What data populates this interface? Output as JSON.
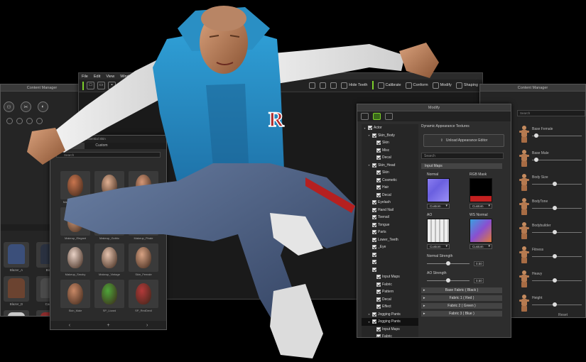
{
  "left_manager": {
    "title": "Content Manager",
    "jackets": [
      {
        "label": "Blazer_A",
        "color": "#3b4f7a"
      },
      {
        "label": "Blaz",
        "color": "#2a3140"
      },
      {
        "label": "Blazer_D",
        "color": "#6b4330"
      },
      {
        "label": "Cardi",
        "color": "#4a4a4a"
      },
      {
        "label": "Cardigan_C",
        "color": "#c9c9c9"
      },
      {
        "label": "Card",
        "color": "#8a2b2b"
      },
      {
        "label": "Hoodie_B",
        "color": "#2e6fb5"
      },
      {
        "label": "Hoo",
        "color": "#3da0d6"
      }
    ]
  },
  "app": {
    "menu": [
      "File",
      "Edit",
      "View",
      "Window"
    ],
    "toolbar": {
      "hide_teeth": "Hide Teeth",
      "calibrate": "Calibrate",
      "conform": "Conform",
      "modify": "Modify",
      "shaping": "Shaping"
    }
  },
  "template_panel": {
    "breadcrumb": "Special  ▸  Essential Skin",
    "tabs": [
      "Template",
      "Custom"
    ],
    "search_placeholder": "Search",
    "faces": [
      {
        "label": "Makeup_Bohemian",
        "color": "#c9754e"
      },
      {
        "label": "Makeup_Classic",
        "color": "#e0b092"
      },
      {
        "label": "Makeup_Diva",
        "color": "#d49777"
      },
      {
        "label": "Makeup_Elegant",
        "color": "#d9a07d"
      },
      {
        "label": "Makeup_Gothic",
        "color": "#eed7cf"
      },
      {
        "label": "Makeup_Pirate",
        "color": "#c98a63"
      },
      {
        "label": "Makeup_Smoky",
        "color": "#e9d2c6"
      },
      {
        "label": "Makeup_Vintage",
        "color": "#e5c3ae"
      },
      {
        "label": "Skin_Female",
        "color": "#d8a384"
      },
      {
        "label": "Skin_Male",
        "color": "#c88866"
      },
      {
        "label": "SP_Lizard",
        "color": "#4fa53a"
      },
      {
        "label": "SP_RedDevil",
        "color": "#b33a3a"
      }
    ],
    "footer": [
      "‹",
      "+",
      "›"
    ]
  },
  "right_manager": {
    "title": "Content Manager",
    "search_placeholder": "Search",
    "bodies": [
      {
        "label": "Base Female",
        "value": 0.05
      },
      {
        "label": "Base Male",
        "value": 0.05
      },
      {
        "label": "Body Size",
        "value": 0.45
      },
      {
        "label": "BodyTone",
        "value": 0.45
      },
      {
        "label": "Bodybuilder",
        "value": 0.45
      },
      {
        "label": "Fitness",
        "value": 0.45
      },
      {
        "label": "Heavy",
        "value": 0.45
      },
      {
        "label": "Height",
        "value": 0.45
      }
    ],
    "reset": "Reset"
  },
  "modify_panel": {
    "title": "Modify",
    "tree": [
      {
        "label": "Actor",
        "indent": 0,
        "arrow": true
      },
      {
        "label": "Skin_Body",
        "indent": 1,
        "arrow": true
      },
      {
        "label": "Skin",
        "indent": 2
      },
      {
        "label": "Misc",
        "indent": 2
      },
      {
        "label": "Decal",
        "indent": 2
      },
      {
        "label": "Skin_Head",
        "indent": 1,
        "arrow": true
      },
      {
        "label": "Skin",
        "indent": 2
      },
      {
        "label": "Cosmetic",
        "indent": 2
      },
      {
        "label": "Hair",
        "indent": 2
      },
      {
        "label": "Decal",
        "indent": 2
      },
      {
        "label": "Eyelash",
        "indent": 1
      },
      {
        "label": "Hand Nail",
        "indent": 1
      },
      {
        "label": "Toenail",
        "indent": 1
      },
      {
        "label": "Tongue",
        "indent": 1
      },
      {
        "label": "Parts",
        "indent": 1
      },
      {
        "label": "Lower_Teeth",
        "indent": 1
      },
      {
        "label": "_Eye",
        "indent": 1
      },
      {
        "label": "",
        "indent": 1
      },
      {
        "label": "",
        "indent": 1
      },
      {
        "label": "",
        "indent": 1
      },
      {
        "label": "Input Maps",
        "indent": 2
      },
      {
        "label": "Fabric",
        "indent": 2
      },
      {
        "label": "Pattern",
        "indent": 2
      },
      {
        "label": "Decal",
        "indent": 2
      },
      {
        "label": "Effect",
        "indent": 2
      },
      {
        "label": "Jogging Pants",
        "indent": 1,
        "arrow": true
      },
      {
        "label": "Jogging Pants",
        "indent": 1,
        "selected": true,
        "arrow": true
      },
      {
        "label": "Input Maps",
        "indent": 2
      },
      {
        "label": "Fabric",
        "indent": 2
      },
      {
        "label": "Pattern",
        "indent": 2
      }
    ],
    "heading": "Dynamic Appearance Textures",
    "unload_button": "Unload Appearance Editor",
    "search_placeholder": "Search",
    "section": "Input Maps",
    "maps": [
      {
        "label": "Normal",
        "dropdown": "Custom"
      },
      {
        "label": "RGB Mask",
        "dropdown": "Custom"
      },
      {
        "label": "AO",
        "dropdown": "Custom"
      },
      {
        "label": "WS Normal",
        "dropdown": "Custom"
      }
    ],
    "normal_strength": {
      "label": "Normal Strength",
      "value": "0.50",
      "fraction": 0.5
    },
    "ao_strength": {
      "label": "AO Strength",
      "value": "0.50",
      "fraction": 0.5
    },
    "fabrics": [
      "Base Fabric ( Black )",
      "Fabric 1 ( Red )",
      "Fabric 2 ( Green )",
      "Fabric 3 ( Blue )"
    ]
  }
}
